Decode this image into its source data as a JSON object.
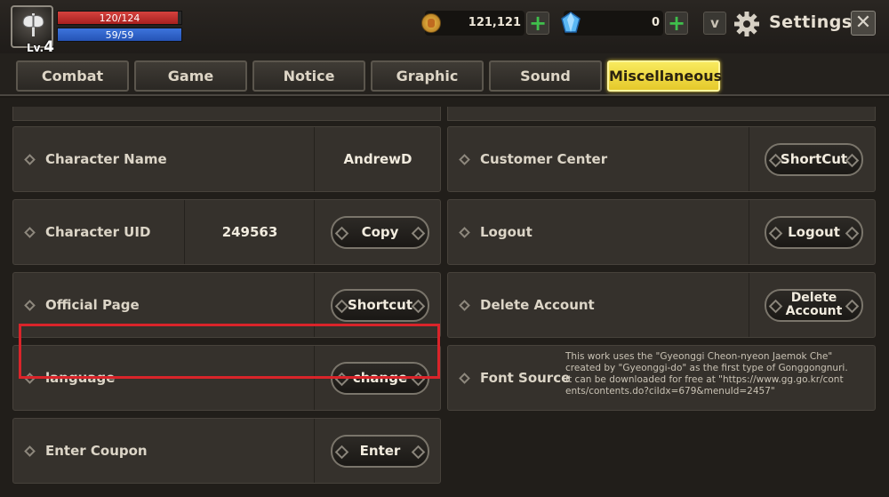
{
  "player": {
    "level_prefix": "Lv.",
    "level": "4",
    "hp_text": "120/124",
    "mp_text": "59/59"
  },
  "currency": {
    "gold": "121,121",
    "gems": "0"
  },
  "header": {
    "title": "Settings"
  },
  "tabs": [
    {
      "label": "Combat"
    },
    {
      "label": "Game"
    },
    {
      "label": "Notice"
    },
    {
      "label": "Graphic"
    },
    {
      "label": "Sound"
    },
    {
      "label": "Miscellaneous",
      "active": true
    }
  ],
  "left_rows": {
    "character_name": {
      "label": "Character Name",
      "value": "AndrewD"
    },
    "character_uid": {
      "label": "Character UID",
      "value": "249563",
      "button": "Copy"
    },
    "official_page": {
      "label": "Official Page",
      "button": "Shortcut"
    },
    "language": {
      "label": "language",
      "button": "change"
    },
    "coupon": {
      "label": "Enter Coupon",
      "button": "Enter"
    }
  },
  "right_rows": {
    "customer_center": {
      "label": "Customer Center",
      "button": "ShortCut"
    },
    "logout": {
      "label": "Logout",
      "button": "Logout"
    },
    "delete_account": {
      "label": "Delete Account",
      "button_line1": "Delete",
      "button_line2": "Account"
    },
    "font_source": {
      "label": "Font Source",
      "line1": "This work uses the \"Gyeonggi Cheon-nyeon Jaemok Che\"",
      "line2": "created by \"Gyeonggi-do\" as the first type of Gonggongnuri.",
      "line3": "It can be downloaded for free at \"https://www.gg.go.kr/cont",
      "line4": "ents/contents.do?ciIdx=679&menuId=2457\""
    }
  },
  "colors": {
    "active_tab": "#f3e04a",
    "highlight": "#d9242a",
    "hp": "#c93330",
    "mp": "#3566cc",
    "plus": "#3fbf4c"
  }
}
